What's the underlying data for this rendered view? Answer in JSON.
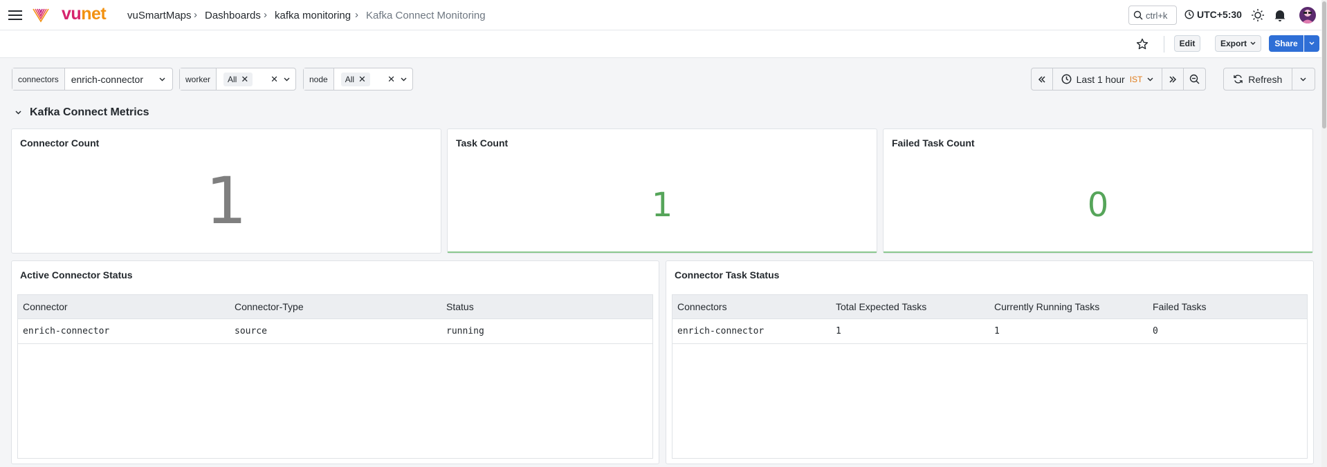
{
  "brand": {
    "logo_text_vu": "vu",
    "logo_text_net": "net"
  },
  "breadcrumb": [
    "vuSmartMaps",
    "Dashboards",
    "kafka monitoring",
    "Kafka Connect Monitoring"
  ],
  "search": {
    "shortcut": "ctrl+k"
  },
  "timezone": "UTC+5:30",
  "toolbar": {
    "edit_label": "Edit",
    "export_label": "Export",
    "share_label": "Share"
  },
  "variables": {
    "connectors": {
      "label": "connectors",
      "value": "enrich-connector"
    },
    "worker": {
      "label": "worker",
      "value": "All"
    },
    "node": {
      "label": "node",
      "value": "All"
    }
  },
  "timepicker": {
    "range": "Last 1 hour",
    "tz": "IST",
    "refresh_label": "Refresh"
  },
  "section": {
    "title": "Kafka Connect Metrics"
  },
  "stats": [
    {
      "title": "Connector Count",
      "value": "1"
    },
    {
      "title": "Task Count",
      "value": "1"
    },
    {
      "title": "Failed Task Count",
      "value": "0"
    }
  ],
  "active_connector_status": {
    "title": "Active Connector Status",
    "columns": [
      "Connector",
      "Connector-Type",
      "Status"
    ],
    "rows": [
      [
        "enrich-connector",
        "source",
        "running"
      ]
    ]
  },
  "connector_task_status": {
    "title": "Connector Task Status",
    "columns": [
      "Connectors",
      "Total Expected Tasks",
      "Currently Running Tasks",
      "Failed Tasks"
    ],
    "rows": [
      [
        "enrich-connector",
        "1",
        "1",
        "0"
      ]
    ]
  },
  "colors": {
    "accent": "#2f6fd6",
    "stat_gray": "#7f7f7f",
    "stat_green": "#56a55a",
    "logo_pink": "#d6246e",
    "logo_orange": "#f29111"
  }
}
